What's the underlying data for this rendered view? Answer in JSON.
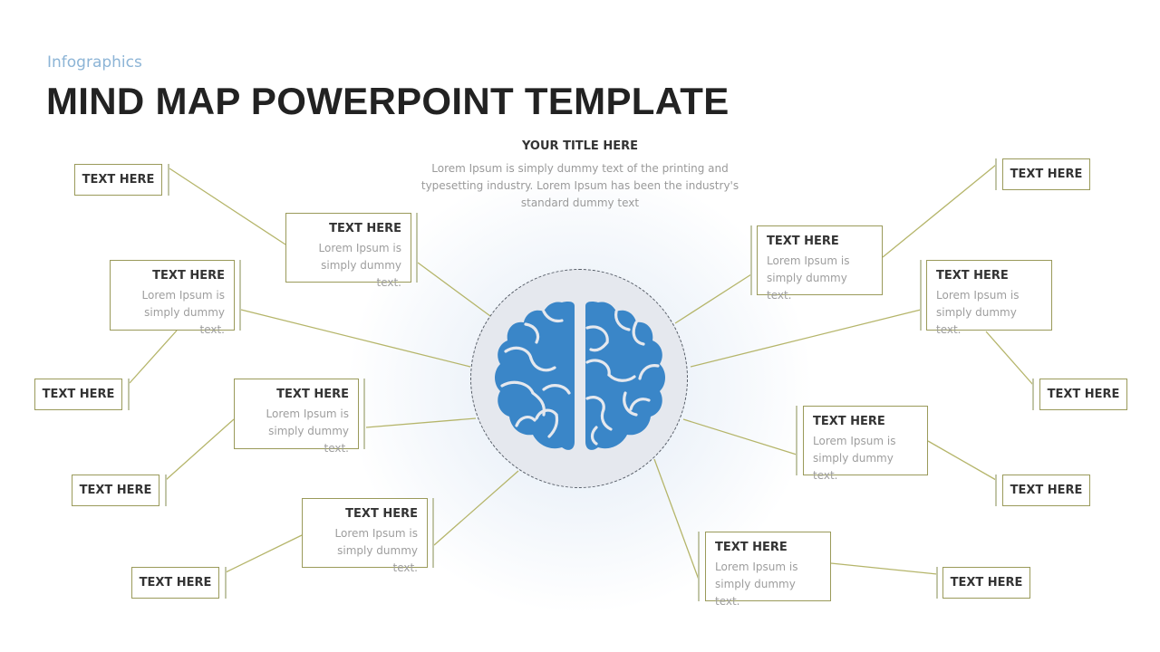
{
  "header": {
    "subtitle": "Infographics",
    "title": "MIND MAP POWERPOINT TEMPLATE"
  },
  "center": {
    "title": "YOUR TITLE HERE",
    "description": "Lorem Ipsum is simply dummy text of the printing and typesetting industry. Lorem Ipsum has been the industry's standard dummy text",
    "icon": "brain-icon"
  },
  "colors": {
    "accent_line": "#b5b56a",
    "box_border": "#9a9a5a",
    "brain_blue": "#3a86c8",
    "hub_fill": "#e5e8ee",
    "subtitle": "#8cb4d6"
  },
  "nodes": {
    "left_primary": [
      {
        "label": "TEXT HERE",
        "desc": "Lorem Ipsum is simply dummy text."
      },
      {
        "label": "TEXT HERE",
        "desc": "Lorem Ipsum is simply dummy text."
      },
      {
        "label": "TEXT HERE",
        "desc": "Lorem Ipsum is simply dummy text."
      },
      {
        "label": "TEXT HERE",
        "desc": "Lorem Ipsum is simply dummy text."
      }
    ],
    "left_secondary": [
      {
        "label": "TEXT HERE"
      },
      {
        "label": "TEXT HERE"
      },
      {
        "label": "TEXT HERE"
      },
      {
        "label": "TEXT HERE"
      }
    ],
    "right_primary": [
      {
        "label": "TEXT HERE",
        "desc": "Lorem Ipsum is simply dummy text."
      },
      {
        "label": "TEXT HERE",
        "desc": "Lorem Ipsum is simply dummy text."
      },
      {
        "label": "TEXT HERE",
        "desc": "Lorem Ipsum is simply dummy text."
      },
      {
        "label": "TEXT HERE",
        "desc": "Lorem Ipsum is simply dummy text."
      }
    ],
    "right_secondary": [
      {
        "label": "TEXT HERE"
      },
      {
        "label": "TEXT HERE"
      },
      {
        "label": "TEXT HERE"
      },
      {
        "label": "TEXT HERE"
      }
    ]
  }
}
